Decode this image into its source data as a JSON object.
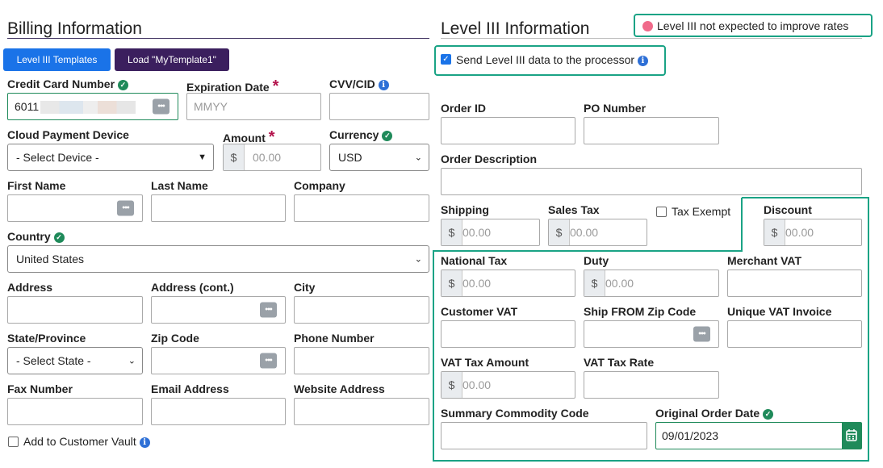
{
  "billing": {
    "title": "Billing Information",
    "templates_button": "Level III Templates",
    "load_button": "Load \"MyTemplate1\"",
    "card_number": {
      "label": "Credit Card Number",
      "value": "6011"
    },
    "expiration": {
      "label": "Expiration Date",
      "placeholder": "MMYY"
    },
    "cvv": {
      "label": "CVV/CID"
    },
    "cloud_device": {
      "label": "Cloud Payment Device",
      "value": "- Select Device -"
    },
    "amount": {
      "label": "Amount",
      "prefix": "$",
      "placeholder": "00.00"
    },
    "currency": {
      "label": "Currency",
      "value": "USD"
    },
    "first_name": {
      "label": "First Name"
    },
    "last_name": {
      "label": "Last Name"
    },
    "company": {
      "label": "Company"
    },
    "country": {
      "label": "Country",
      "value": "United States"
    },
    "address": {
      "label": "Address"
    },
    "address2": {
      "label": "Address (cont.)"
    },
    "city": {
      "label": "City"
    },
    "state": {
      "label": "State/Province",
      "value": "- Select State -"
    },
    "zip": {
      "label": "Zip Code"
    },
    "phone": {
      "label": "Phone Number"
    },
    "fax": {
      "label": "Fax Number"
    },
    "email": {
      "label": "Email Address"
    },
    "website": {
      "label": "Website Address"
    },
    "vault": {
      "label": "Add to Customer Vault",
      "checked": false
    }
  },
  "level3": {
    "title": "Level III Information",
    "notice": "Level III not expected to improve rates",
    "send_data": {
      "label": "Send Level III data to the processor",
      "checked": true
    },
    "order_id": {
      "label": "Order ID"
    },
    "po_number": {
      "label": "PO Number"
    },
    "order_description": {
      "label": "Order Description"
    },
    "shipping": {
      "label": "Shipping",
      "prefix": "$",
      "placeholder": "00.00"
    },
    "sales_tax": {
      "label": "Sales Tax",
      "prefix": "$",
      "placeholder": "00.00"
    },
    "tax_exempt": {
      "label": "Tax Exempt",
      "checked": false
    },
    "discount": {
      "label": "Discount",
      "prefix": "$",
      "placeholder": "00.00"
    },
    "national_tax": {
      "label": "National Tax",
      "prefix": "$",
      "placeholder": "00.00"
    },
    "duty": {
      "label": "Duty",
      "prefix": "$",
      "placeholder": "00.00"
    },
    "merchant_vat": {
      "label": "Merchant VAT"
    },
    "customer_vat": {
      "label": "Customer VAT"
    },
    "ship_from_zip": {
      "label": "Ship FROM Zip Code"
    },
    "unique_vat_invoice": {
      "label": "Unique VAT Invoice"
    },
    "vat_tax_amount": {
      "label": "VAT Tax Amount",
      "prefix": "$",
      "placeholder": "00.00"
    },
    "vat_tax_rate": {
      "label": "VAT Tax Rate"
    },
    "summary_commodity": {
      "label": "Summary Commodity Code"
    },
    "original_order_date": {
      "label": "Original Order Date",
      "value": "09/01/2023"
    }
  },
  "colors": {
    "accent_teal": "#1aa385",
    "primary_blue": "#1a73e8",
    "dark_purple": "#3b1f5e",
    "required_red": "#b3134c",
    "valid_green": "#1f8a5a",
    "notice_dot": "#f06a8a"
  }
}
